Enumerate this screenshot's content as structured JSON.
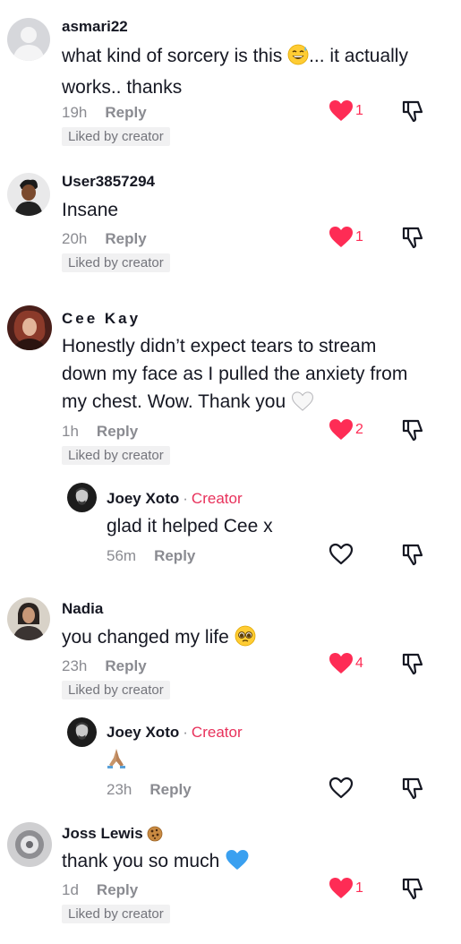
{
  "comments": [
    {
      "username": "asmari22",
      "text_parts": [
        "what kind of sorcery is this ",
        "... it actually works.. thanks"
      ],
      "time": "19h",
      "reply": "Reply",
      "likes": "1",
      "liked_by_creator": "Liked by creator"
    },
    {
      "username": "User3857294",
      "text": "Insane",
      "time": "20h",
      "reply": "Reply",
      "likes": "1",
      "liked_by_creator": "Liked by creator"
    },
    {
      "username": "Cee Kay",
      "text_line1": "Honestly didn’t expect tears to stream",
      "text_line2": "down my face as I pulled the anxiety from",
      "text_line3": "my chest. Wow. Thank you",
      "time": "1h",
      "reply": "Reply",
      "likes": "2",
      "liked_by_creator": "Liked by creator",
      "replies": [
        {
          "username": "Joey Xoto",
          "separator": "·",
          "tag": "Creator",
          "text": "glad it helped Cee x",
          "time": "56m",
          "reply": "Reply"
        }
      ]
    },
    {
      "username": "Nadia",
      "text": "you changed my life",
      "time": "23h",
      "reply": "Reply",
      "likes": "4",
      "liked_by_creator": "Liked by creator",
      "replies": [
        {
          "username": "Joey Xoto",
          "separator": "·",
          "tag": "Creator",
          "text_emoji": "folded-hands-emoji",
          "time": "23h",
          "reply": "Reply"
        }
      ]
    },
    {
      "username": "Joss Lewis",
      "username_emoji": "cookie-emoji",
      "text": "thank you so much",
      "time": "1d",
      "reply": "Reply",
      "likes": "1",
      "liked_by_creator": "Liked by creator"
    }
  ],
  "icons": {
    "like": "heart-icon",
    "dislike": "thumbs-down-icon"
  },
  "colors": {
    "liked_heart": "#fe2c55",
    "creator_tag": "#e8315b",
    "meta_text": "#8a8b91"
  }
}
